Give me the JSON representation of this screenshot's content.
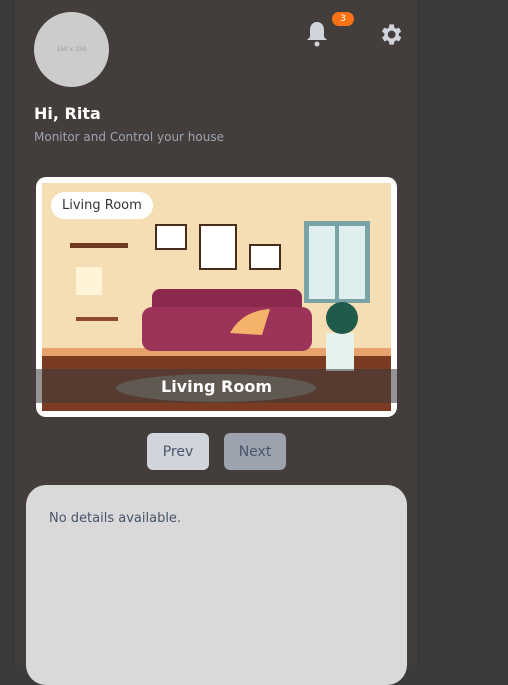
{
  "header": {
    "avatar_placeholder": "150 x 150",
    "notification_count": "3",
    "greeting": "Hi, Rita",
    "subtitle": "Monitor and Control your house"
  },
  "room_card": {
    "tag": "Living Room",
    "caption": "Living Room"
  },
  "nav": {
    "prev": "Prev",
    "next": "Next"
  },
  "details": {
    "text": "No details available."
  },
  "colors": {
    "badge": "#f97316",
    "panel": "#433e3b",
    "sofa": "#8b2a4e"
  }
}
